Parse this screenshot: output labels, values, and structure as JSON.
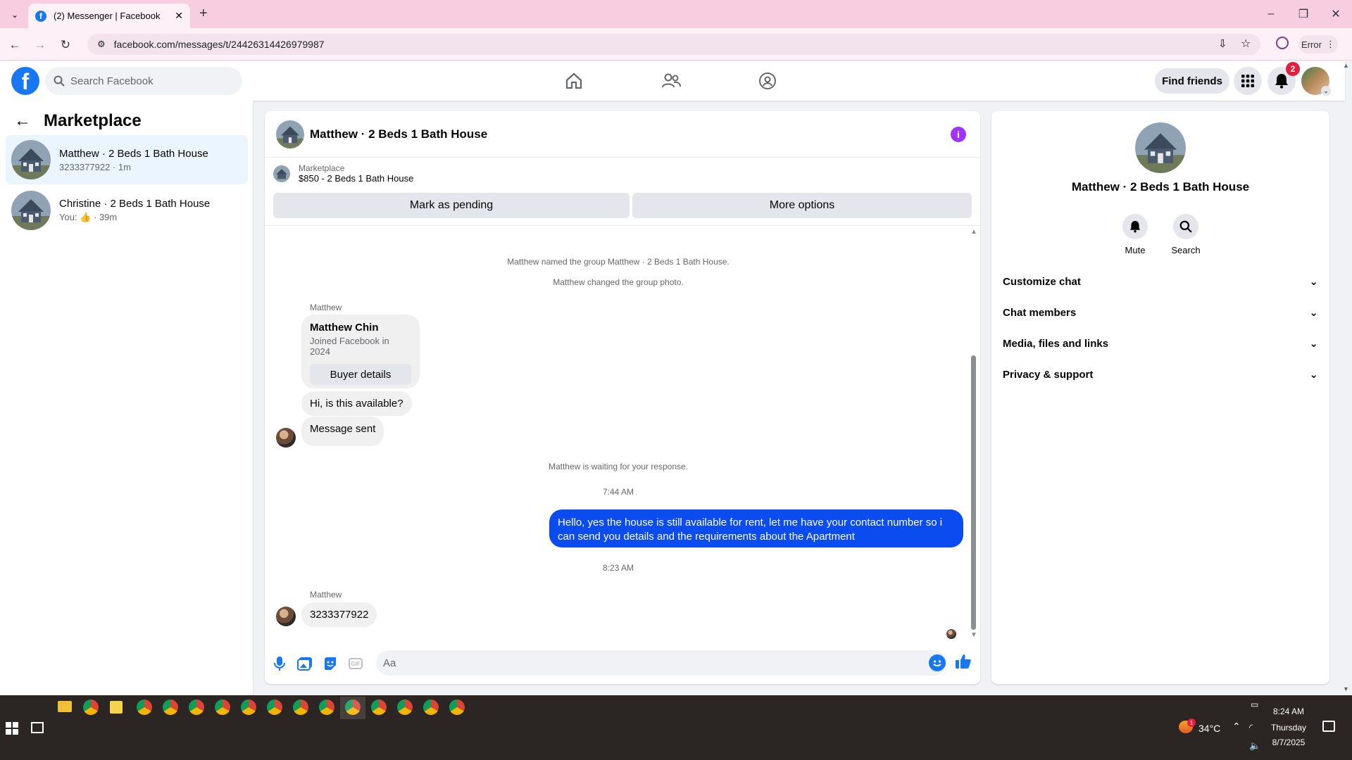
{
  "browser": {
    "tab_title": "(2) Messenger | Facebook",
    "url": "facebook.com/messages/t/24426314426979987",
    "error_label": "Error"
  },
  "fb": {
    "search_placeholder": "Search Facebook",
    "find_friends": "Find friends",
    "notif_count": "2",
    "logo_letter": "f"
  },
  "sidebar": {
    "title": "Marketplace",
    "conversations": [
      {
        "name": "Matthew · 2 Beds 1 Bath House",
        "sub": "3233377922 · 1m"
      },
      {
        "name": "Christine · 2 Beds 1 Bath House",
        "sub_prefix": "You:",
        "sub_suffix": "· 39m"
      }
    ]
  },
  "chat": {
    "title": "Matthew · 2 Beds 1 Bath House",
    "listing_label": "Marketplace",
    "listing_text": "$850 - 2 Beds 1 Bath House",
    "mark_pending": "Mark as pending",
    "more_options": "More options",
    "sys1": "Matthew named the group Matthew · 2 Beds 1 Bath House.",
    "sys2": "Matthew changed the group photo.",
    "sender1": "Matthew",
    "card_name": "Matthew Chin",
    "card_joined": "Joined Facebook in 2024",
    "card_button": "Buyer details",
    "msg1": "Hi, is this available?",
    "msg2": "Message sent",
    "waiting": "Matthew is waiting for your response.",
    "time1": "7:44 AM",
    "outgoing": "Hello, yes the house is still available for rent, let me have your contact number so i can send you details and the requirements about the  Apartment",
    "time2": "8:23 AM",
    "sender2": "Matthew",
    "msg3": "3233377922",
    "composer_placeholder": "Aa"
  },
  "details": {
    "title": "Matthew · 2 Beds 1 Bath House",
    "mute": "Mute",
    "search": "Search",
    "sections": [
      "Customize chat",
      "Chat members",
      "Media, files and links",
      "Privacy & support"
    ]
  },
  "taskbar": {
    "temp": "34°C",
    "weather_badge": "1",
    "time": "8:24 AM",
    "day": "Thursday",
    "date": "8/7/2025"
  },
  "colors": {
    "fb_blue": "#1877f2",
    "outgoing_bubble": "#0a4cf0",
    "tab_strip": "#f8cde0",
    "badge_red": "#e41e3f",
    "info_purple": "#a033ff"
  }
}
